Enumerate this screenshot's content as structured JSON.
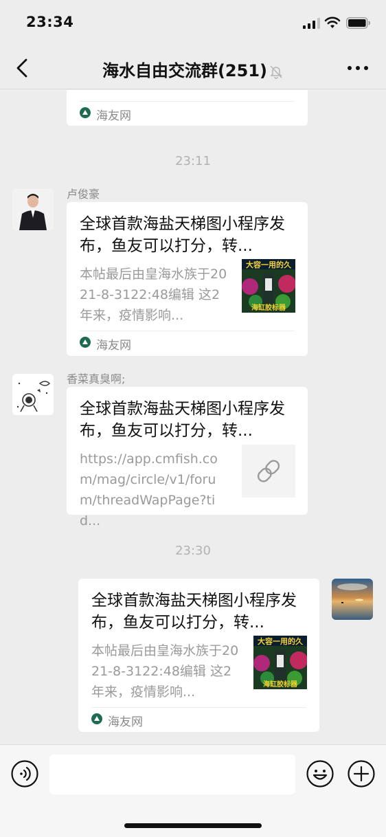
{
  "status": {
    "time": "23:34"
  },
  "header": {
    "title": "海水自由交流群(251)"
  },
  "timestamps": [
    "23:11",
    "23:30"
  ],
  "messages": [
    {
      "source": "海友网"
    },
    {
      "sender": "卢俊豪",
      "title": "全球首款海盐天梯图小程序发布，鱼友可以打分，转...",
      "desc": "本帖最后由皇海水族于2021-8-3122:48编辑 这2年来，疫情影响...",
      "source": "海友网",
      "thumb_text": "大容一用的久",
      "thumb_sub": "海缸胶标器"
    },
    {
      "sender": "香菜真臭啊;",
      "title": "全球首款海盐天梯图小程序发布，鱼友可以打分，转...",
      "desc": "https://app.cmfish.com/mag/circle/v1/forum/threadWapPage?tid..."
    },
    {
      "title": "全球首款海盐天梯图小程序发布，鱼友可以打分，转...",
      "desc": "本帖最后由皇海水族于2021-8-3122:48编辑 这2年来，疫情影响...",
      "source": "海友网",
      "thumb_text": "大容一用的久",
      "thumb_sub": "海缸胶标器"
    }
  ],
  "colors": {
    "background": "#ededed",
    "bubble": "#ffffff",
    "source_icon": "#1e6b52",
    "meta_text": "#8a8a8a"
  },
  "icons": [
    "back-icon",
    "mute-icon",
    "more-icon",
    "voice-icon",
    "emoji-icon",
    "plus-icon",
    "link-icon",
    "signal-icon",
    "wifi-icon",
    "battery-icon"
  ]
}
